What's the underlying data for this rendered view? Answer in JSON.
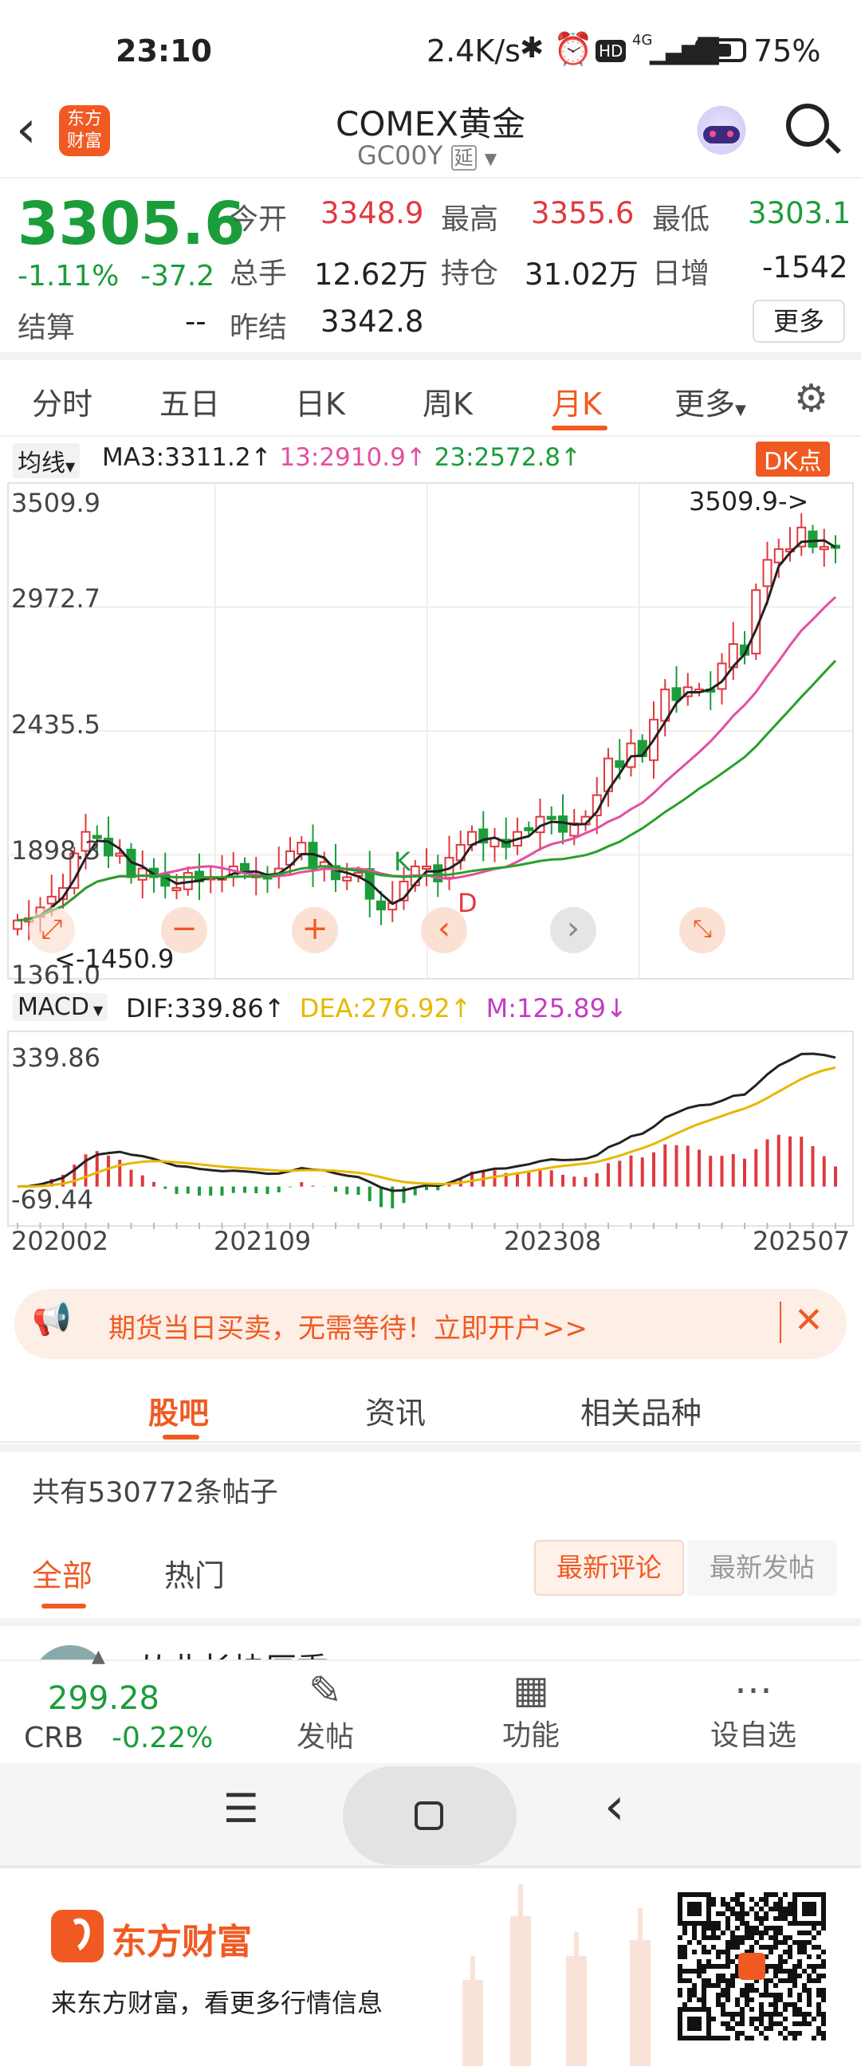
{
  "status_bar": {
    "time": "23:10",
    "net_speed": "2.4K/s",
    "signal": "4G",
    "battery": "75%"
  },
  "header": {
    "title": "COMEX黄金",
    "code": "GC00Y",
    "delay_tag": "延",
    "logo_text": "东方财富"
  },
  "quote": {
    "price": "3305.6",
    "change_pct": "-1.11%",
    "change": "-37.2",
    "open_label": "今开",
    "open": "3348.9",
    "high_label": "最高",
    "high": "3355.6",
    "low_label": "最低",
    "low": "3303.1",
    "volume_label": "总手",
    "volume": "12.62万",
    "oi_label": "持仓",
    "oi": "31.02万",
    "daily_inc_label": "日增",
    "daily_inc": "-1542",
    "settle_label": "结算",
    "settle": "--",
    "prev_settle_label": "昨结",
    "prev_settle": "3342.8",
    "more_label": "更多"
  },
  "period_tabs": {
    "t1": "分时",
    "t2": "五日",
    "t3": "日K",
    "t4": "周K",
    "t5": "月K",
    "t6": "更多",
    "active": "月K"
  },
  "ma_legend": {
    "selector": "均线",
    "ma3": "MA3:3311.2",
    "ma13": "13:2910.9",
    "ma23": "23:2572.8",
    "dk": "DK点"
  },
  "chart_data": [
    {
      "type": "candlestick",
      "ylim": [
        1361.0,
        3509.9
      ],
      "y_ticks": [
        "3509.9",
        "2972.7",
        "2435.5",
        "1898.3",
        "1361.0"
      ],
      "max_label": "3509.9->",
      "min_label": "<-1450.9",
      "markers": [
        {
          "text": "K",
          "color": "#1b9d3a"
        },
        {
          "text": "D",
          "color": "#e0393e"
        }
      ],
      "x_ticks": [
        "202002",
        "202109",
        "202308",
        "202507"
      ],
      "close": [
        1580,
        1590,
        1640,
        1690,
        1730,
        1890,
        1990,
        1965,
        1880,
        1890,
        1780,
        1820,
        1780,
        1740,
        1730,
        1800,
        1760,
        1780,
        1780,
        1830,
        1800,
        1790,
        1780,
        1820,
        1900,
        1940,
        1820,
        1850,
        1770,
        1780,
        1800,
        1680,
        1630,
        1660,
        1760,
        1830,
        1830,
        1760,
        1870,
        1930,
        1990,
        1940,
        1960,
        1920,
        1990,
        2000,
        2060,
        2050,
        1990,
        2030,
        2060,
        2160,
        2330,
        2290,
        2400,
        2340,
        2510,
        2650,
        2600,
        2660,
        2650,
        2640,
        2770,
        2860,
        2810,
        3110,
        3250,
        3300,
        3300,
        3400,
        3310,
        3310,
        3305.6
      ],
      "ma_series": [
        {
          "name": "MA3",
          "color": "#222222",
          "value": "3311.2"
        },
        {
          "name": "13",
          "color": "#e34fa0",
          "value": "2910.9"
        },
        {
          "name": "23",
          "color": "#2aa02a",
          "value": "2572.8"
        }
      ]
    },
    {
      "type": "bar",
      "indicator": "MACD",
      "dif_label": "DIF:339.86",
      "dea_label": "DEA:276.92",
      "m_label": "M:125.89",
      "y_ticks": [
        "339.86",
        "-69.44"
      ],
      "ylim": [
        -69.44,
        339.86
      ]
    }
  ],
  "promo": {
    "text": "期货当日买卖，无需等待！立即开户>>"
  },
  "sub_tabs": {
    "t1": "股吧",
    "t2": "资讯",
    "t3": "相关品种"
  },
  "feed": {
    "count": "共有530772条帖子",
    "f_all": "全部",
    "f_hot": "热门",
    "sort1": "最新评论",
    "sort2": "最新发帖",
    "partial_post": "从业长块厚重"
  },
  "bottom_bar": {
    "ticker_val": "299.28",
    "ticker_name": "CRB",
    "ticker_chg": "-0.22%",
    "post": "发帖",
    "func": "功能",
    "watch": "设自选"
  },
  "footer": {
    "brand": "东方财富",
    "slogan": "来东方财富，看更多行情信息"
  },
  "colors": {
    "up": "#e0393e",
    "down": "#1b9d3a",
    "accent": "#f05a22",
    "dea": "#e6b800",
    "m": "#c43cc4"
  }
}
